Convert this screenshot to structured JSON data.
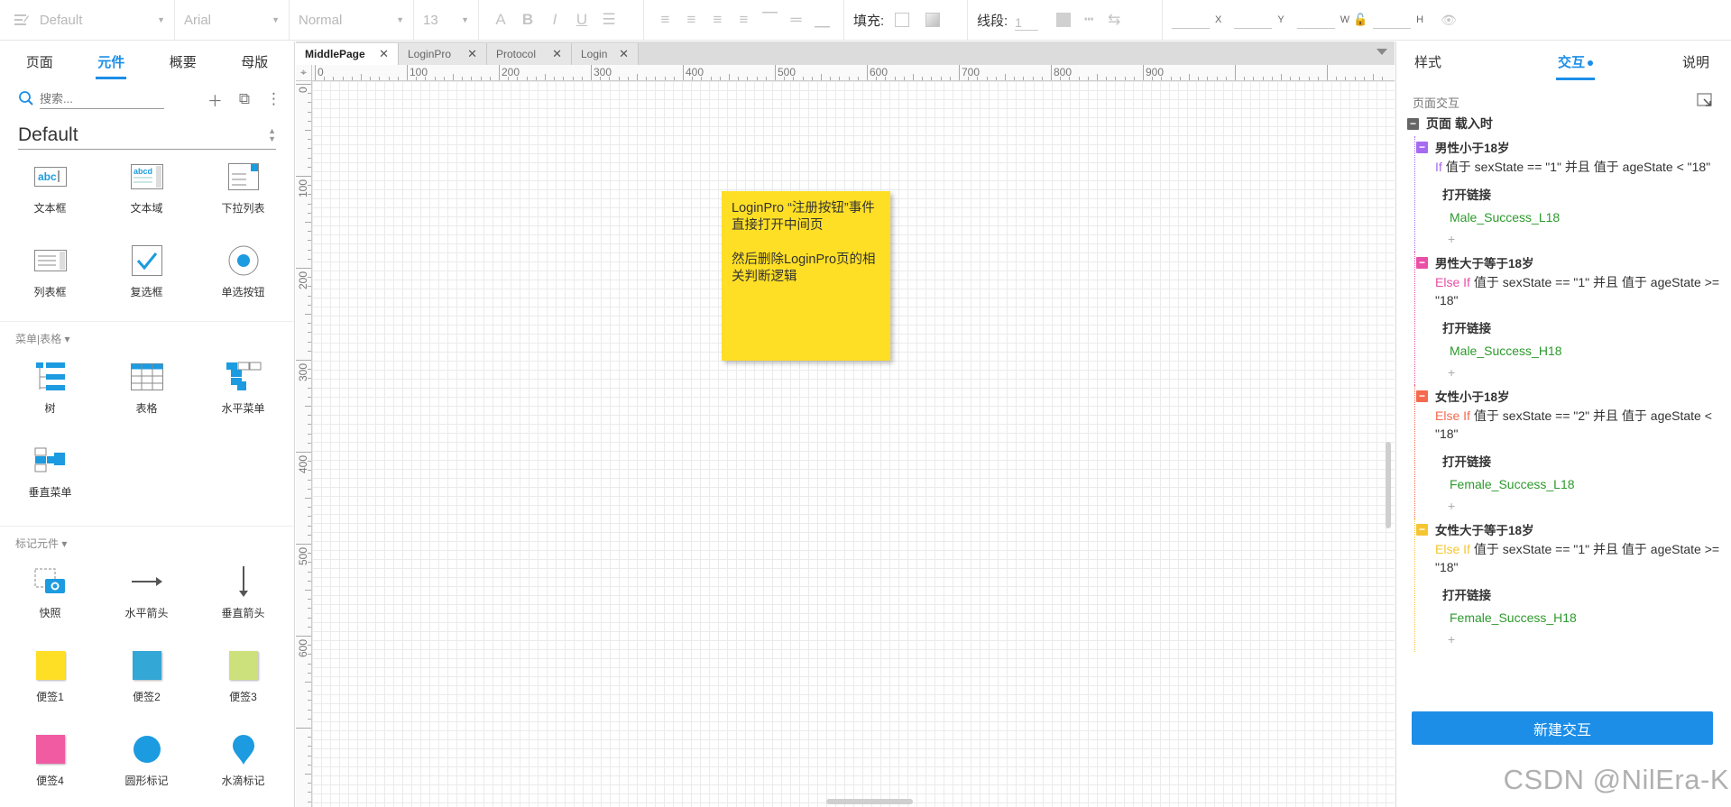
{
  "toolbar": {
    "style_select": "Default",
    "font_select": "Arial",
    "weight_select": "Normal",
    "size_select": "13",
    "fill_label": "填充:",
    "line_label": "线段:",
    "line_value": "1",
    "x_label": "X",
    "y_label": "Y",
    "w_label": "W",
    "h_label": "H"
  },
  "left_panel": {
    "tabs": [
      "页面",
      "元件",
      "概要",
      "母版"
    ],
    "active_tab": "元件",
    "search_placeholder": "搜索...",
    "library_name": "Default",
    "widgets_top": [
      {
        "label": "文本框",
        "icon": "textbox-icon"
      },
      {
        "label": "文本域",
        "icon": "textarea-icon"
      },
      {
        "label": "下拉列表",
        "icon": "dropdown-list-icon"
      },
      {
        "label": "列表框",
        "icon": "listbox-icon"
      },
      {
        "label": "复选框",
        "icon": "checkbox-icon"
      },
      {
        "label": "单选按钮",
        "icon": "radio-button-icon"
      }
    ],
    "menu_section": "菜单|表格 ▾",
    "widgets_menu": [
      {
        "label": "树",
        "icon": "tree-icon"
      },
      {
        "label": "表格",
        "icon": "table-icon"
      },
      {
        "label": "水平菜单",
        "icon": "horizontal-menu-icon"
      },
      {
        "label": "垂直菜单",
        "icon": "vertical-menu-icon"
      }
    ],
    "marker_section": "标记元件 ▾",
    "widgets_marker": [
      {
        "label": "快照",
        "icon": "snapshot-icon"
      },
      {
        "label": "水平箭头",
        "icon": "horizontal-arrow-icon"
      },
      {
        "label": "垂直箭头",
        "icon": "vertical-arrow-icon"
      },
      {
        "label": "便签1",
        "icon": "sticky-note-icon",
        "color": "#ffdf25"
      },
      {
        "label": "便签2",
        "icon": "sticky-note-icon",
        "color": "#33a7d6"
      },
      {
        "label": "便签3",
        "icon": "sticky-note-icon",
        "color": "#cce17b"
      },
      {
        "label": "便签4",
        "icon": "sticky-note-icon",
        "color": "#f05ba2"
      },
      {
        "label": "圆形标记",
        "icon": "circle-marker-icon",
        "color": "#1c9be0"
      },
      {
        "label": "水滴标记",
        "icon": "drop-marker-icon",
        "color": "#1c9be0"
      }
    ]
  },
  "canvas": {
    "tabs": [
      "MiddlePage",
      "LoginPro",
      "Protocol",
      "Login"
    ],
    "active_tab": "MiddlePage",
    "ruler_h": [
      "0",
      "100",
      "200",
      "300",
      "400",
      "500",
      "600",
      "700",
      "800",
      "900"
    ],
    "ruler_v": [
      "0",
      "100",
      "200",
      "300",
      "400",
      "500",
      "600"
    ],
    "sticky_line1": "LoginPro “注册按钮”事件直接打开中间页",
    "sticky_line2": "然后删除LoginPro页的相关判断逻辑",
    "sticky_color": "#ffdf25"
  },
  "right_panel": {
    "tabs": [
      "样式",
      "交互",
      "说明"
    ],
    "active_tab": "交互",
    "section_title": "页面交互",
    "event_title": "页面 载入时",
    "cases": [
      {
        "name": "男性小于18岁",
        "color": "#a66bf0",
        "keyword": "If",
        "kw_color": "#a66bf0",
        "condition": "值于 sexState == \"1\" 并且 值于 ageState < \"18\"",
        "action": "打开链接",
        "target": "Male_Success_L18"
      },
      {
        "name": "男性大于等于18岁",
        "color": "#e94fa5",
        "keyword": "Else If",
        "kw_color": "#e94fa5",
        "condition": "值于 sexState == \"1\" 并且 值于 ageState >= \"18\"",
        "action": "打开链接",
        "target": "Male_Success_H18"
      },
      {
        "name": "女性小于18岁",
        "color": "#f4694f",
        "keyword": "Else If",
        "kw_color": "#f4694f",
        "condition": "值于 sexState == \"2\" 并且 值于 ageState < \"18\"",
        "action": "打开链接",
        "target": "Female_Success_L18"
      },
      {
        "name": "女性大于等于18岁",
        "color": "#f6c632",
        "keyword": "Else If",
        "kw_color": "#f6c632",
        "condition": "值于 sexState == \"1\" 并且 值于 ageState >= \"18\"",
        "action": "打开链接",
        "target": "Female_Success_H18"
      }
    ],
    "plus": "+",
    "new_button": "新建交互",
    "watermark": "CSDN @NilEra-K"
  },
  "colors": {
    "accent": "#1c8ee8",
    "link_green": "#2c9a2c",
    "sticky_yellow": "#ffdf25"
  }
}
